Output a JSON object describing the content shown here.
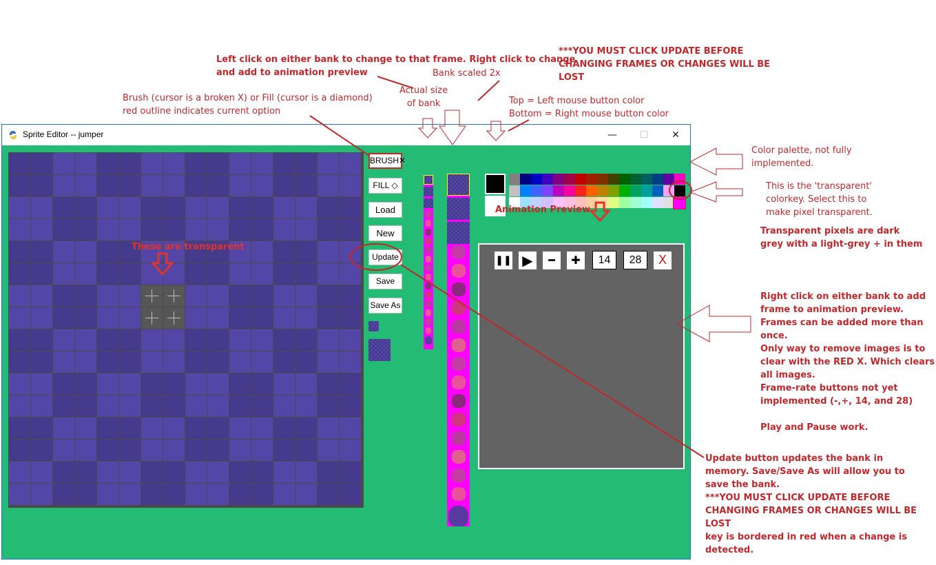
{
  "window": {
    "title": "Sprite Editor  --  jumper",
    "minimize": "—",
    "maximize": "☐",
    "close": "✕"
  },
  "tools": {
    "brush": "BRUSH✕",
    "fill": "FILL ◇",
    "load": "Load",
    "new": "New",
    "update": "Update",
    "save": "Save",
    "save_as": "Save As"
  },
  "animation": {
    "pause": "❚❚",
    "play": "▶",
    "minus": "━",
    "plus": "✚",
    "rate_a": "14",
    "rate_b": "28",
    "clear": "X"
  },
  "colors": {
    "left_mouse": "#000000",
    "right_mouse": "#ffffff",
    "transparent_key": "#ff00ff",
    "palette_row1": [
      "#808080",
      "#000080",
      "#0000c0",
      "#4000c0",
      "#800080",
      "#a0004a",
      "#c00000",
      "#a02000",
      "#803000",
      "#404000",
      "#006000",
      "#006030",
      "#006060",
      "#004080",
      "#6000a0",
      "#ff00c0"
    ],
    "palette_row2": [
      "#c0c0c0",
      "#0080ff",
      "#4060ff",
      "#8040ff",
      "#c000c0",
      "#ff00a0",
      "#ff2020",
      "#ff6000",
      "#c08000",
      "#80a000",
      "#00b000",
      "#00a060",
      "#00a0a0",
      "#0060c0",
      "#ffa0ff",
      "#000000"
    ],
    "palette_row3": [
      "#ffffff",
      "#a0e0ff",
      "#c0d0ff",
      "#d0c0ff",
      "#ffc0ff",
      "#ffc0e0",
      "#ffc0c0",
      "#ffd0a0",
      "#ffe0a0",
      "#e0ff80",
      "#a0ffa0",
      "#a0ffd0",
      "#a0ffff",
      "#e0e0ff",
      "#e0e0e0",
      "#000000"
    ]
  },
  "annotations": {
    "bank_click": "Left click on either bank to change to that frame.  Right click to change\nand add to animation preview",
    "must_update_top": "***YOU MUST CLICK UPDATE BEFORE\nCHANGING FRAMES OR CHANGES WILL BE\nLOST",
    "bank_scaled": "Bank scaled 2x",
    "actual_size": "Actual size\nof bank",
    "brush_fill": "Brush (cursor is a broken X) or Fill (cursor is a diamond)\nred outline indicates current option",
    "mouse_colors": "Top = Left mouse button color\nBottom = Right mouse button color",
    "palette": "Color palette, not fully\nimplemented.",
    "colorkey": "This is the 'transparent'\ncolorkey.  Select this to\nmake pixel transparent.",
    "transparent_pixels": "Transparent pixels are dark\ngrey with a light-grey + in them",
    "animation_preview": "Animation Preview",
    "these_transparent": "These are transparent",
    "right_click_info": "Right click on either bank to add\nframe to animation preview.\nFrames can be added more than\nonce.\nOnly way to remove images is to\nclear with the RED X. Which clears\nall images.\nFrame-rate buttons not yet\nimplemented (-,+, 14, and 28)\n\nPlay and Pause work.",
    "update_info": "Update button updates the bank in\nmemory.  Save/Save As will allow you to\nsave the bank.\n***YOU MUST CLICK UPDATE BEFORE\nCHANGING FRAMES OR CHANGES WILL BE\nLOST\nkey is bordered in red when a change is\ndetected."
  }
}
